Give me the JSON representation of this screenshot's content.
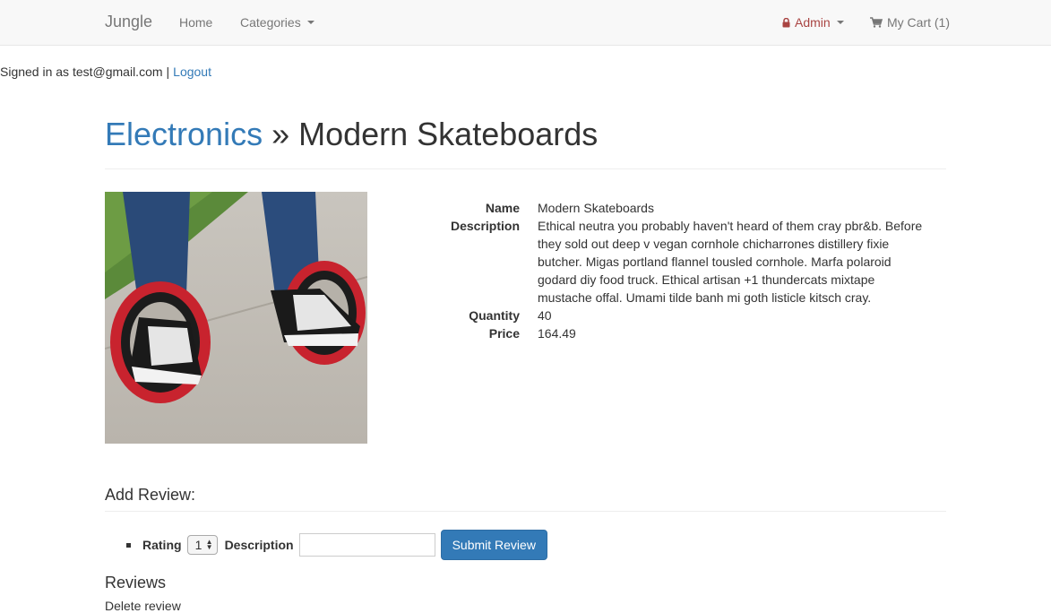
{
  "navbar": {
    "brand": "Jungle",
    "home": "Home",
    "categories": "Categories",
    "admin": "Admin",
    "cart": "My Cart (1)"
  },
  "session": {
    "signed_in_text": "Signed in as test@gmail.com",
    "separator": "|",
    "logout": "Logout"
  },
  "header": {
    "category": "Electronics",
    "separator": " » ",
    "product": "Modern Skateboards"
  },
  "product": {
    "name_label": "Name",
    "name": "Modern Skateboards",
    "description_label": "Description",
    "description": "Ethical neutra you probably haven't heard of them cray pbr&b. Before they sold out deep v vegan cornhole chicharrones distillery fixie butcher. Migas portland flannel tousled cornhole. Marfa polaroid godard diy food truck. Ethical artisan +1 thundercats mixtape mustache offal. Umami tilde banh mi goth listicle kitsch cray.",
    "quantity_label": "Quantity",
    "quantity": "40",
    "price_label": "Price",
    "price": "164.49"
  },
  "review_form": {
    "title": "Add Review:",
    "rating_label": "Rating",
    "rating_value": "1",
    "description_label": "Description",
    "description_value": "",
    "submit": "Submit Review"
  },
  "reviews": {
    "title": "Reviews",
    "cut_text": "Delete review"
  },
  "colors": {
    "link": "#337ab7",
    "admin": "#a94442",
    "navbar_bg": "#f8f8f8",
    "button": "#337ab7"
  }
}
